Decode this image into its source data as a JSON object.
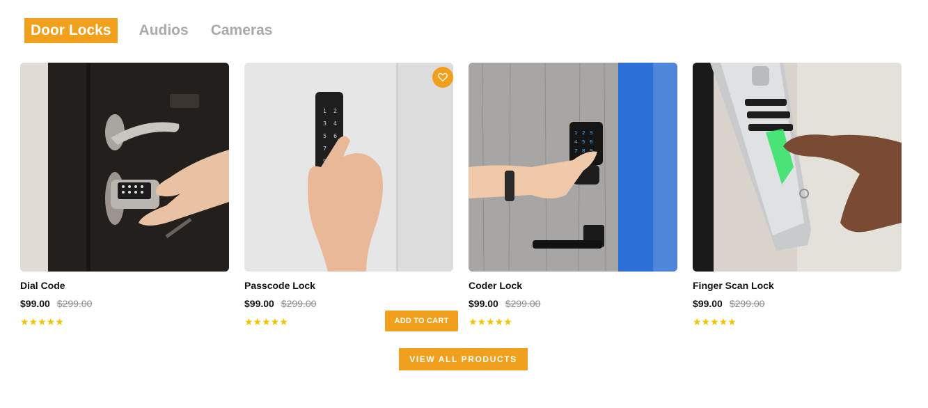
{
  "tabs": [
    {
      "label": "Door Locks",
      "active": true
    },
    {
      "label": "Audios",
      "active": false
    },
    {
      "label": "Cameras",
      "active": false
    }
  ],
  "products": [
    {
      "title": "Dial Code",
      "price": "$99.00",
      "old_price": "$299.00",
      "rating": 5,
      "stars": "★★★★★",
      "image_icon": "door-handle-keypad-icon"
    },
    {
      "title": "Passcode Lock",
      "price": "$99.00",
      "old_price": "$299.00",
      "rating": 5,
      "stars": "★★★★★",
      "image_icon": "wall-keypad-icon"
    },
    {
      "title": "Coder Lock",
      "price": "$99.00",
      "old_price": "$299.00",
      "rating": 5,
      "stars": "★★★★★",
      "image_icon": "deadbolt-keypad-icon"
    },
    {
      "title": "Finger Scan Lock",
      "price": "$99.00",
      "old_price": "$299.00",
      "rating": 5,
      "stars": "★★★★★",
      "image_icon": "fingerprint-scanner-icon"
    }
  ],
  "actions": {
    "add_to_cart": "ADD TO CART",
    "view_all": "VIEW ALL PRODUCTS"
  },
  "colors": {
    "accent": "#f0a01c",
    "star": "#f2c400",
    "muted_tab": "#a9a9a9"
  }
}
